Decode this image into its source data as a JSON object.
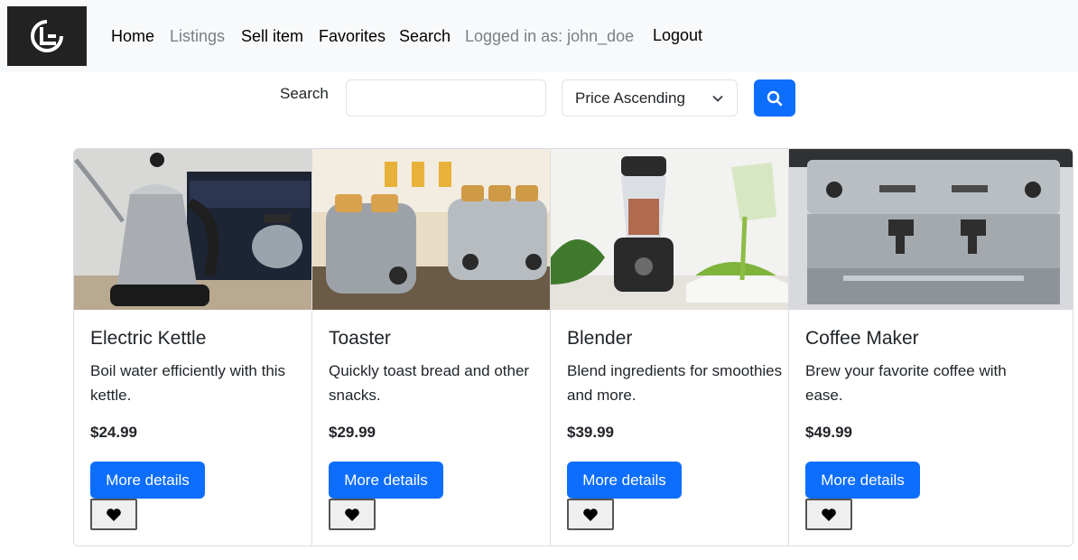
{
  "nav": {
    "logo_icon": "brand-logo-icon",
    "links": [
      "Home",
      "Listings",
      "Sell item",
      "Favorites",
      "Search",
      "Logged in as: john_doe",
      "Logout"
    ]
  },
  "search": {
    "label": "Search",
    "value": "",
    "placeholder": "",
    "sort_selected": "Price Ascending",
    "button_icon": "search-icon"
  },
  "colors": {
    "primary": "#0d6efd",
    "navbar_bg": "#f8f9fa",
    "muted": "#7a7f85"
  },
  "products": [
    {
      "name": "Electric Kettle",
      "description": "Boil water efficiently with this kettle.",
      "price": "$24.99",
      "button": "More details",
      "image": "electric-kettle-image"
    },
    {
      "name": "Toaster",
      "description": "Quickly toast bread and other snacks.",
      "price": "$29.99",
      "button": "More details",
      "image": "toaster-image"
    },
    {
      "name": "Blender",
      "description": "Blend ingredients for smoothies and more.",
      "price": "$39.99",
      "button": "More details",
      "image": "blender-image"
    },
    {
      "name": "Coffee Maker",
      "description": "Brew your favorite coffee with ease.",
      "price": "$49.99",
      "button": "More details",
      "image": "coffee-maker-image"
    }
  ]
}
